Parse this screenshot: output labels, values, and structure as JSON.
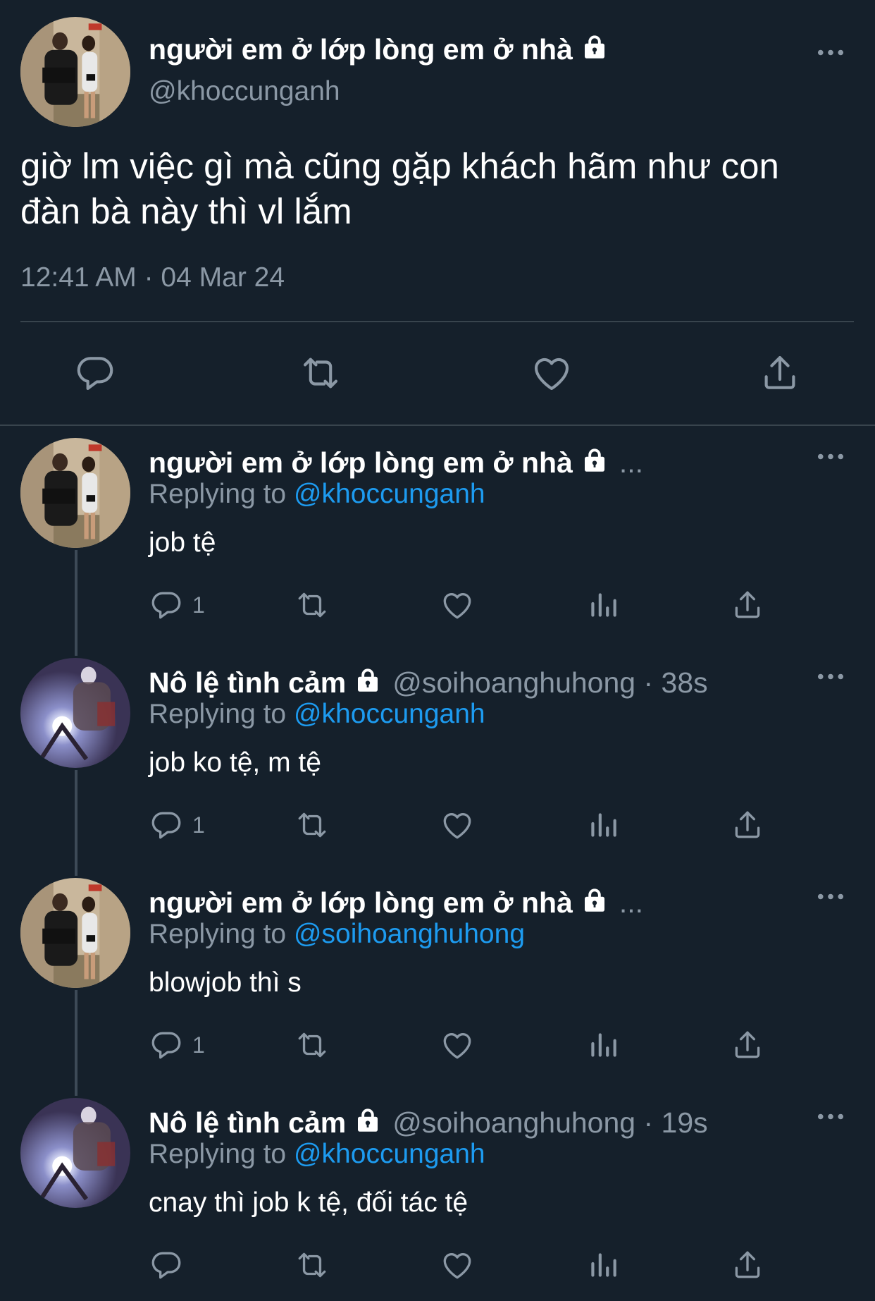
{
  "main_tweet": {
    "display_name": "người em ở lớp lòng em ở nhà",
    "handle": "@khoccunganh",
    "text_line1": "giờ lm việc gì mà cũng gặp khách hãm như con",
    "text_line2": "đàn bà này thì vl lắm",
    "timestamp": "12:41 AM · 04 Mar 24"
  },
  "replies": [
    {
      "display_name": "người em ở lớp lòng em ở nhà",
      "name_suffix": "...",
      "replying_prefix": "Replying to",
      "replying_to": "@khoccunganh",
      "text": "job tệ",
      "reply_count": "1"
    },
    {
      "display_name": "Nô lệ tình cảm",
      "handle_time": "@soihoanghuhong · 38s",
      "replying_prefix": "Replying to",
      "replying_to": "@khoccunganh",
      "text": "job ko tệ, m tệ",
      "reply_count": "1"
    },
    {
      "display_name": "người em ở lớp lòng em ở nhà",
      "name_suffix": "...",
      "replying_prefix": "Replying to",
      "replying_to": "@soihoanghuhong",
      "text": "blowjob thì s",
      "reply_count": "1"
    },
    {
      "display_name": "Nô lệ tình cảm",
      "handle_time": "@soihoanghuhong · 19s",
      "replying_prefix": "Replying to",
      "replying_to": "@khoccunganh",
      "text": "cnay thì job k tệ, đối tác tệ",
      "reply_count": ""
    }
  ],
  "icons": {
    "reply": "reply-icon",
    "retweet": "retweet-icon",
    "like": "like-icon",
    "views": "views-icon",
    "share": "share-icon",
    "more": "more-icon",
    "lock": "lock-icon"
  },
  "colors": {
    "background": "#15202b",
    "text": "#ffffff",
    "secondary": "#8b98a5",
    "link": "#1d9bf0",
    "divider": "#38444d"
  }
}
